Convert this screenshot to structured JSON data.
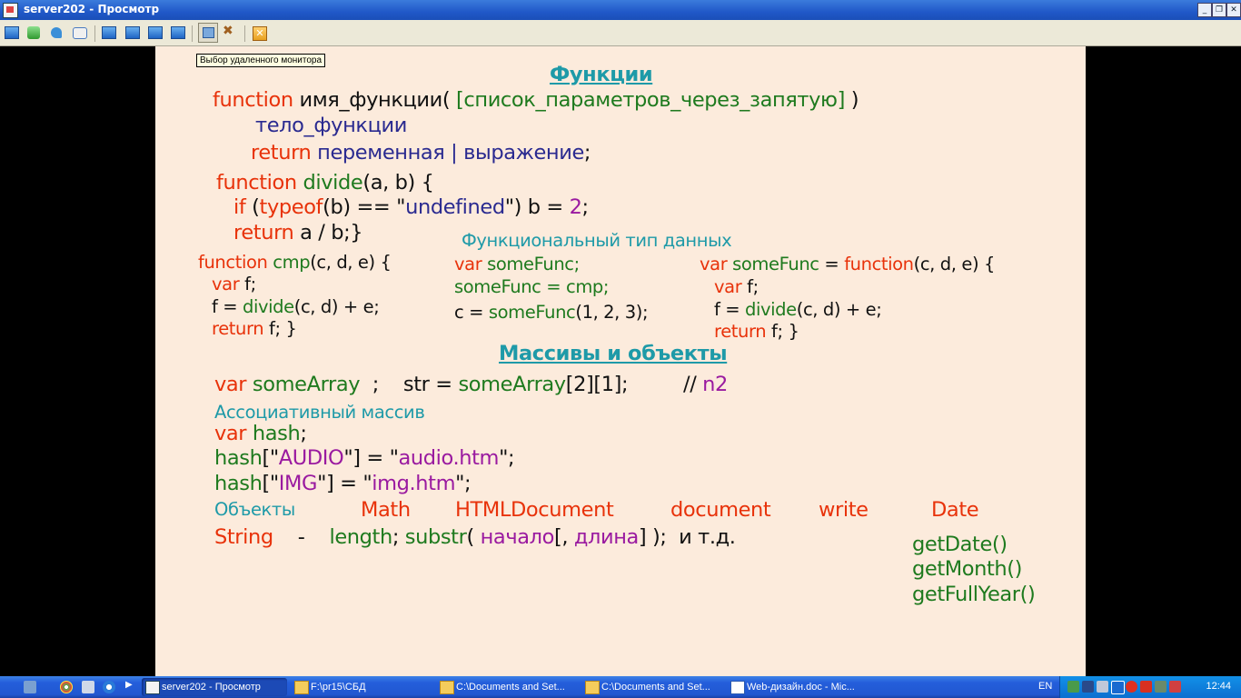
{
  "window": {
    "title": "server202 - Просмотр",
    "buttons": [
      "minimize",
      "restore",
      "close"
    ]
  },
  "toolbar": {
    "icons": [
      "monitor-icon",
      "sync-icon",
      "phone-icon",
      "chat-icon",
      "window-icon",
      "fullscreen-icon",
      "screen-icon",
      "refresh-icon",
      "select-monitor-icon",
      "tools-icon",
      "exit-icon"
    ],
    "tooltip": "Выбор удаленного монитора"
  },
  "slide": {
    "heading_functions": "Функции",
    "l1_kw": "function",
    "l1_name": "имя_функции(",
    "l1_params": "[список_параметров_через_запятую]",
    "l1_close": ")",
    "l2_body": "тело_функции",
    "l3_kw": "return",
    "l3_expr": "переменная | выражение",
    "l3_semi": ";",
    "d1_kw": "function",
    "d1_name": "divide",
    "d1_args": "(a, b) {",
    "d2_if": "if",
    "d2_open": "(",
    "d2_typeof": "typeof",
    "d2_mid": "(b) == \"",
    "d2_undef": "undefined",
    "d2_rest": "\") b = ",
    "d2_two": "2",
    "d2_semi": ";",
    "d3_kw": "return",
    "d3_rest": "a / b;}",
    "functional_type_label": "Функциональный тип данных",
    "c1_kw": "function",
    "c1_name": "cmp",
    "c1_args": "(c, d, e) {",
    "c2_kw": "var",
    "c2_rest": "f;",
    "c3_f": "f =",
    "c3_divide": "divide",
    "c3_rest": "(c, d) + e;",
    "c4_kw": "return",
    "c4_rest": "f; }",
    "m1_kw": "var",
    "m1_rest": "someFunc;",
    "m2_text": "someFunc = cmp;",
    "m3_c": "c =",
    "m3_fn": "someFunc",
    "m3_rest": "(1, 2, 3);",
    "r1_kw": "var",
    "r1_name": "someFunc",
    "r1_eq": "=",
    "r1_fn": "function",
    "r1_rest": "(c, d, e) {",
    "r2_kw": "var",
    "r2_rest": "f;",
    "r3_f": "f =",
    "r3_divide": "divide",
    "r3_rest": "(c, d) + e;",
    "r4_kw": "return",
    "r4_rest": "f; }",
    "heading_arrays": "Массивы и объекты",
    "a1_kw": "var",
    "a1_name": "someArray",
    "a1_semi": ";",
    "a1_str": "str =",
    "a1_access": "someArray",
    "a1_idx": "[2][1];",
    "a1_comment": "//",
    "a1_n2": "n2",
    "assoc_label": "Ассоциативный массив",
    "h1_kw": "var",
    "h1_name": "hash",
    "h1_semi": ";",
    "h2_hash": "hash",
    "h2_ob": "[\"",
    "h2_key": "AUDIO",
    "h2_cb": "\"] = \"",
    "h2_val": "audio.htm",
    "h2_end": "\";",
    "h3_hash": "hash",
    "h3_ob": "[\"",
    "h3_key": "IMG",
    "h3_cb": "\"] = \"",
    "h3_val": "img.htm",
    "h3_end": "\";",
    "objects_label": "Объекты",
    "obj_items": [
      "Math",
      "HTMLDocument",
      "document",
      "write",
      "Date"
    ],
    "s1_string": "String",
    "s1_dash": "-",
    "s1_length": "length",
    "s1_semi": ";",
    "s1_substr": "substr",
    "s1_open": "(",
    "s1_start": "начало",
    "s1_opt": "[,",
    "s1_len": "длина",
    "s1_close": "] );",
    "s1_etc": "и т.д.",
    "date_methods": [
      "getDate()",
      "getMonth()",
      "getFullYear()"
    ]
  },
  "taskbar": {
    "items": [
      {
        "label": "server202 - Просмотр",
        "icon": "app-icon",
        "active": true
      },
      {
        "label": "F:\\pr15\\СБД",
        "icon": "folder-icon",
        "active": false
      },
      {
        "label": "C:\\Documents and Set...",
        "icon": "folder-icon",
        "active": false
      },
      {
        "label": "C:\\Documents and Set...",
        "icon": "folder-icon",
        "active": false
      },
      {
        "label": "Web-дизайн.doc - Mic...",
        "icon": "word-icon",
        "active": false
      }
    ],
    "lang": "EN",
    "clock": "12:44"
  }
}
